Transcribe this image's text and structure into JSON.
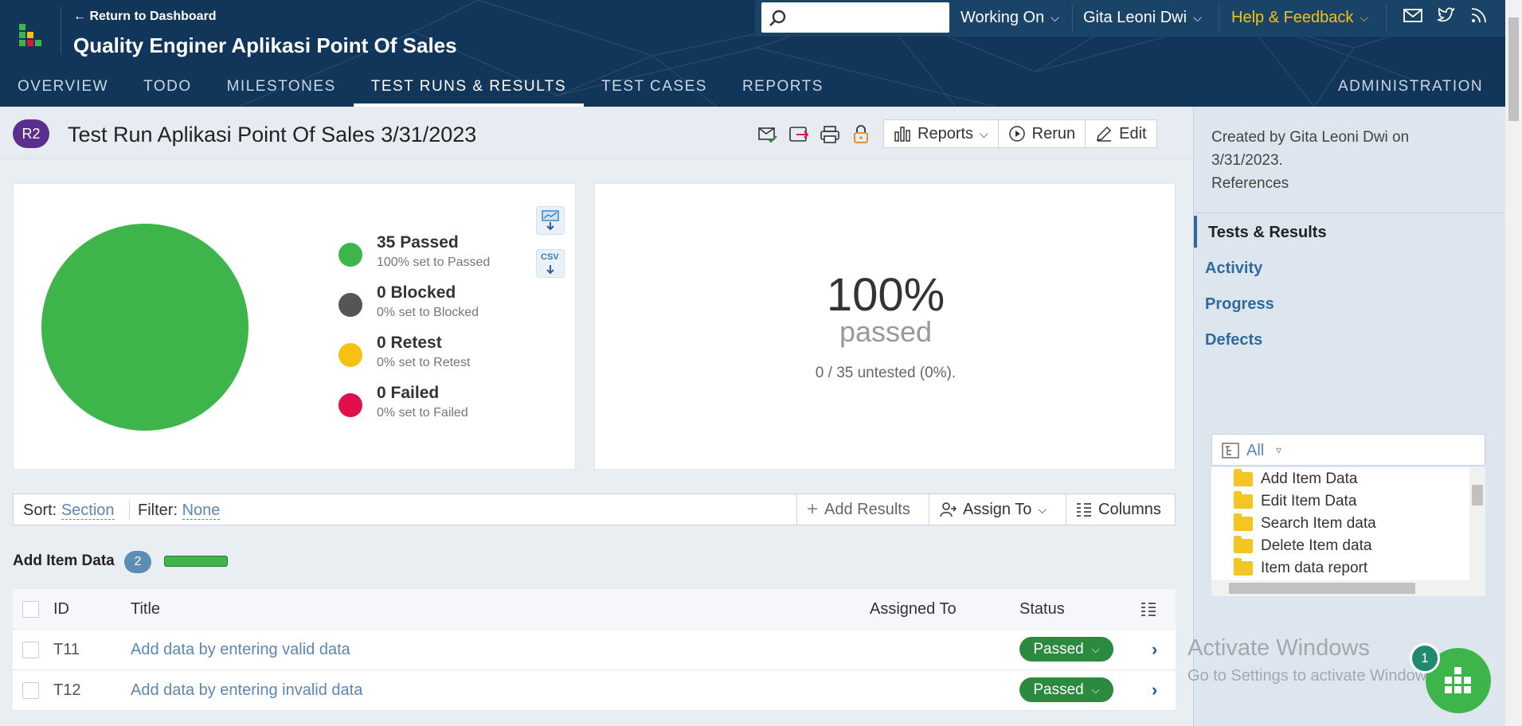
{
  "app": {
    "back_link": "← Return to Dashboard",
    "project_title": "Quality Enginer Aplikasi Point Of Sales",
    "colors": {
      "nav_bg": "#11365a",
      "passed": "#3db54a",
      "blocked": "#555555",
      "retest": "#f5c211",
      "failed": "#e0104a",
      "accent": "#f5c211"
    }
  },
  "topmenu": {
    "search_placeholder": "",
    "working_on": "Working On",
    "user": "Gita Leoni Dwi",
    "help": "Help & Feedback",
    "icons": [
      "mail-icon",
      "twitter-icon",
      "rss-icon"
    ]
  },
  "tabs": [
    "OVERVIEW",
    "TODO",
    "MILESTONES",
    "TEST RUNS & RESULTS",
    "TEST CASES",
    "REPORTS"
  ],
  "active_tab": "TEST RUNS & RESULTS",
  "admin": "ADMINISTRATION",
  "run": {
    "badge": "R2",
    "title": "Test Run Aplikasi Point Of Sales 3/31/2023",
    "reports": "Reports",
    "rerun": "Rerun",
    "edit": "Edit"
  },
  "summary": {
    "legend": [
      {
        "title": "35 Passed",
        "sub": "100% set to Passed"
      },
      {
        "title": "0 Blocked",
        "sub": "0% set to Blocked"
      },
      {
        "title": "0 Retest",
        "sub": "0% set to Retest"
      },
      {
        "title": "0 Failed",
        "sub": "0% set to Failed"
      }
    ],
    "csv": "CSV",
    "percent": "100%",
    "passed_label": "passed",
    "untested": "0 / 35 untested (0%)."
  },
  "chart_data": {
    "type": "pie",
    "categories": [
      "Passed",
      "Blocked",
      "Retest",
      "Failed"
    ],
    "values": [
      35,
      0,
      0,
      0
    ]
  },
  "filterbar": {
    "sort_label": "Sort:",
    "sort_value": "Section",
    "filter_label": "Filter:",
    "filter_value": "None",
    "add_results": "Add Results",
    "assign_to": "Assign To",
    "columns": "Columns"
  },
  "section": {
    "name": "Add Item Data",
    "count": "2",
    "progress": 1.0
  },
  "table": {
    "headers": {
      "id": "ID",
      "title": "Title",
      "assigned": "Assigned To",
      "status": "Status"
    },
    "rows": [
      {
        "id": "T11",
        "title": "Add data by entering valid data",
        "status": "Passed"
      },
      {
        "id": "T12",
        "title": "Add data by entering invalid data",
        "status": "Passed"
      }
    ]
  },
  "sidebar": {
    "created_line1": "Created by Gita Leoni Dwi on",
    "created_line2": "3/31/2023.",
    "references": "References",
    "nav": [
      "Tests & Results",
      "Activity",
      "Progress",
      "Defects"
    ],
    "tree_filter": "All",
    "tree": [
      "Add Item Data",
      "Edit Item Data",
      "Search Item data",
      "Delete Item data",
      "Item data report"
    ]
  },
  "watermark": {
    "line1": "Activate Windows",
    "line2": "Go to Settings to activate Windows."
  },
  "fab_badge": "1"
}
